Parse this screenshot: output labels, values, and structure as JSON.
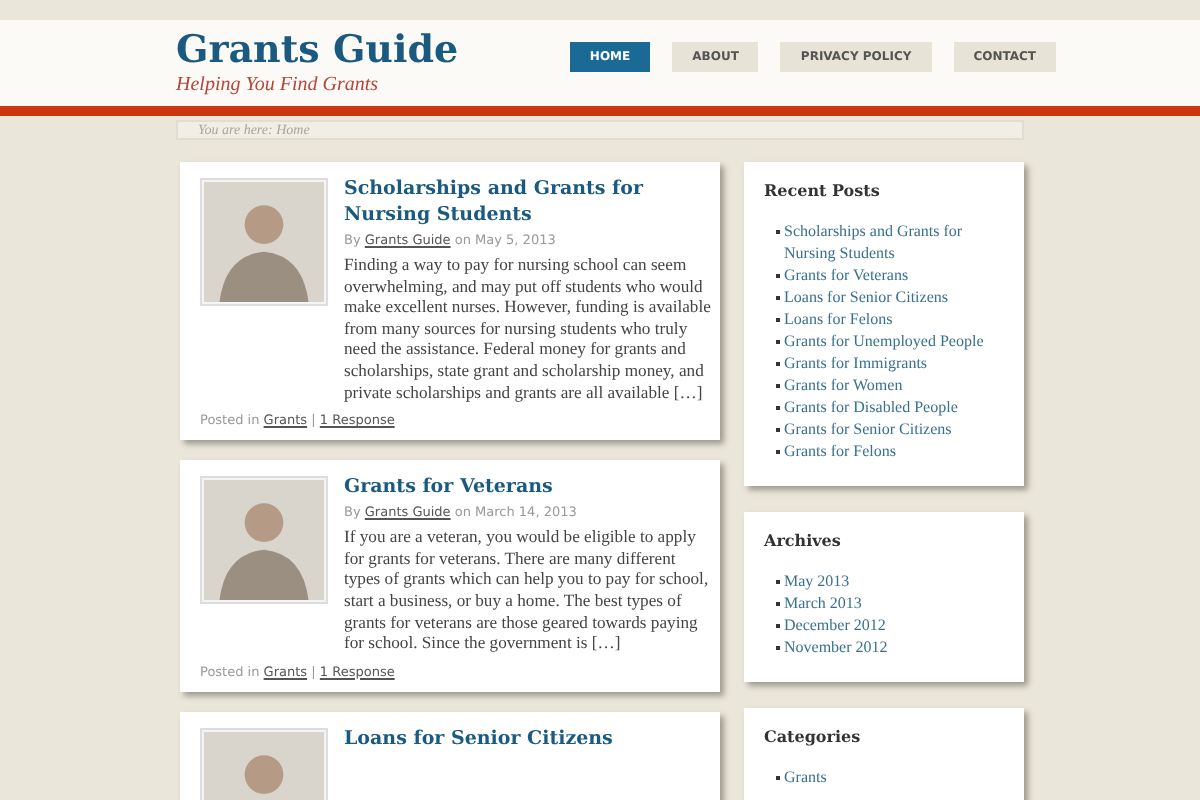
{
  "site": {
    "title": "Grants Guide",
    "tagline": "Helping You Find Grants"
  },
  "nav": [
    {
      "label": "HOME",
      "selected": true
    },
    {
      "label": "ABOUT",
      "selected": false
    },
    {
      "label": "PRIVACY POLICY",
      "selected": false
    },
    {
      "label": "CONTACT",
      "selected": false
    }
  ],
  "breadcrumb": {
    "prefix": "You are here:",
    "current": "Home"
  },
  "posts": [
    {
      "title": "Scholarships and Grants for Nursing Students",
      "by": "By",
      "author": "Grants Guide",
      "on": "on May 5, 2013",
      "excerpt": "Finding a way to pay for nursing school can seem overwhelming, and may put off students who would make excellent nurses. However, funding is available from many sources for nursing students who truly need the assistance. Federal money for grants and scholarships, state grant and scholarship money, and private scholarships and grants are all available […]",
      "posted_in": "Posted in",
      "category": "Grants",
      "separator": "|",
      "responses": "1 Response"
    },
    {
      "title": "Grants for Veterans",
      "by": "By",
      "author": "Grants Guide",
      "on": "on March 14, 2013",
      "excerpt": "If you are a veteran, you would be eligible to apply for grants for veterans.  There are many different types of grants which can help you to pay for school, start a business, or buy a home.  The best types of grants for veterans are those geared towards paying for school.  Since the government is […]",
      "posted_in": "Posted in",
      "category": "Grants",
      "separator": "|",
      "responses": "1 Response"
    },
    {
      "title": "Loans for Senior Citizens"
    }
  ],
  "sidebar": [
    {
      "title": "Recent Posts",
      "items": [
        "Scholarships and Grants for Nursing Students",
        "Grants for Veterans",
        "Loans for Senior Citizens",
        "Loans for Felons",
        "Grants for Unemployed People",
        "Grants for Immigrants",
        "Grants for Women",
        "Grants for Disabled People",
        "Grants for Senior Citizens",
        "Grants for Felons"
      ]
    },
    {
      "title": "Archives",
      "items": [
        "May 2013",
        "March 2013",
        "December 2012",
        "November 2012"
      ]
    },
    {
      "title": "Categories",
      "items": [
        "Grants"
      ]
    }
  ]
}
